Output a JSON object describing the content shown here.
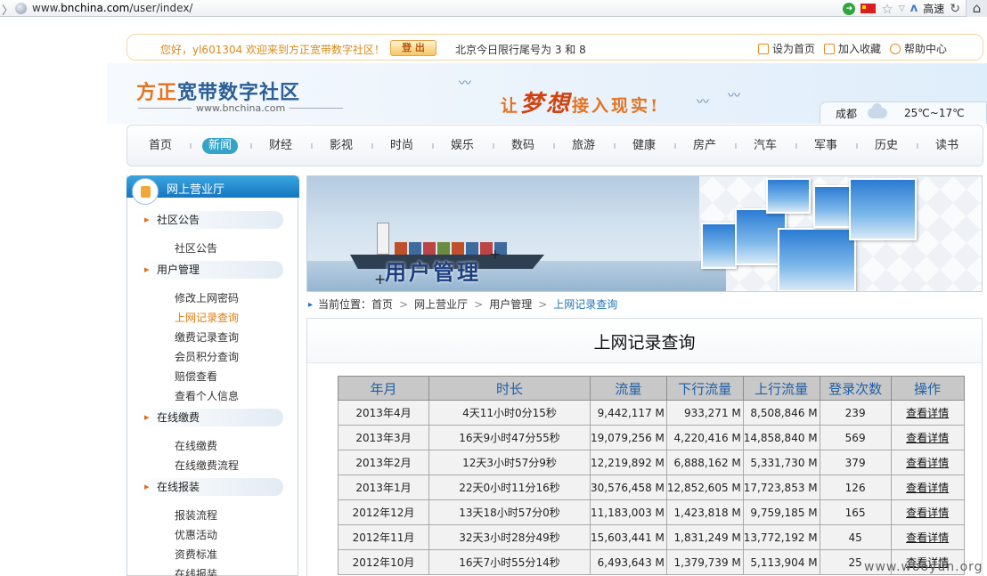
{
  "browser": {
    "url_prefix": "www.",
    "url_domain": "bnchina.com",
    "url_path": "/user/index/",
    "speed_label": "高速"
  },
  "topbar": {
    "welcome": "您好，yl601304 欢迎来到方正宽带数字社区！",
    "logout": "登 出",
    "limit_notice": "北京今日限行尾号为 3 和 8",
    "links": [
      "设为首页",
      "加入收藏",
      "帮助中心"
    ]
  },
  "header": {
    "logo_part1": "方正",
    "logo_part2": "宽带数字社区",
    "logo_sub": "www.bnchina.com",
    "slogan_pre": "让",
    "slogan_big": "梦想",
    "slogan_post": "接入现实!",
    "weather_city": "成都",
    "weather_temp": "25℃~17℃"
  },
  "nav": {
    "items": [
      "首页",
      "新闻",
      "财经",
      "影视",
      "时尚",
      "娱乐",
      "数码",
      "旅游",
      "健康",
      "房产",
      "汽车",
      "军事",
      "历史",
      "读书"
    ],
    "active": "新闻"
  },
  "sidebar": {
    "title": "网上营业厅",
    "sections": [
      {
        "label": "社区公告",
        "items": [
          "社区公告"
        ]
      },
      {
        "label": "用户管理",
        "items": [
          "修改上网密码",
          "上网记录查询",
          "缴费记录查询",
          "会员积分查询",
          "赔偿查看",
          "查看个人信息"
        ]
      },
      {
        "label": "在线缴费",
        "items": [
          "在线缴费",
          "在线缴费流程"
        ]
      },
      {
        "label": "在线报装",
        "items": [
          "报装流程",
          "优惠活动",
          "资费标准",
          "在线报装"
        ]
      }
    ],
    "active_item": "上网记录查询"
  },
  "banner": {
    "title": "用户管理"
  },
  "breadcrumb": {
    "label": "当前位置：",
    "items": [
      "首页",
      "网上营业厅",
      "用户管理"
    ],
    "current": "上网记录查询"
  },
  "main": {
    "title": "上网记录查询",
    "table": {
      "headers": [
        "年月",
        "时长",
        "流量",
        "下行流量",
        "上行流量",
        "登录次数",
        "操作"
      ],
      "rows": [
        [
          "2013年4月",
          "4天11小时0分15秒",
          "9,442,117 M",
          "933,271 M",
          "8,508,846 M",
          "239",
          "查看详情"
        ],
        [
          "2013年3月",
          "16天9小时47分55秒",
          "19,079,256 M",
          "4,220,416 M",
          "14,858,840 M",
          "569",
          "查看详情"
        ],
        [
          "2013年2月",
          "12天3小时57分9秒",
          "12,219,892 M",
          "6,888,162 M",
          "5,331,730 M",
          "379",
          "查看详情"
        ],
        [
          "2013年1月",
          "22天0小时11分16秒",
          "30,576,458 M",
          "12,852,605 M",
          "17,723,853 M",
          "126",
          "查看详情"
        ],
        [
          "2012年12月",
          "13天18小时57分0秒",
          "11,183,003 M",
          "1,423,818 M",
          "9,759,185 M",
          "165",
          "查看详情"
        ],
        [
          "2012年11月",
          "32天3小时28分49秒",
          "15,603,441 M",
          "1,831,249 M",
          "13,772,192 M",
          "45",
          "查看详情"
        ],
        [
          "2012年10月",
          "16天7小时55分14秒",
          "6,493,643 M",
          "1,379,739 M",
          "5,113,904 M",
          "25",
          "查看详情"
        ]
      ]
    }
  },
  "watermark": "www.wooyun.org",
  "colors": {
    "accent_orange": "#e4731e",
    "nav_active": "#35a3c8",
    "sidebar_head": "#1676bf",
    "table_header_text": "#1f5fa8"
  }
}
